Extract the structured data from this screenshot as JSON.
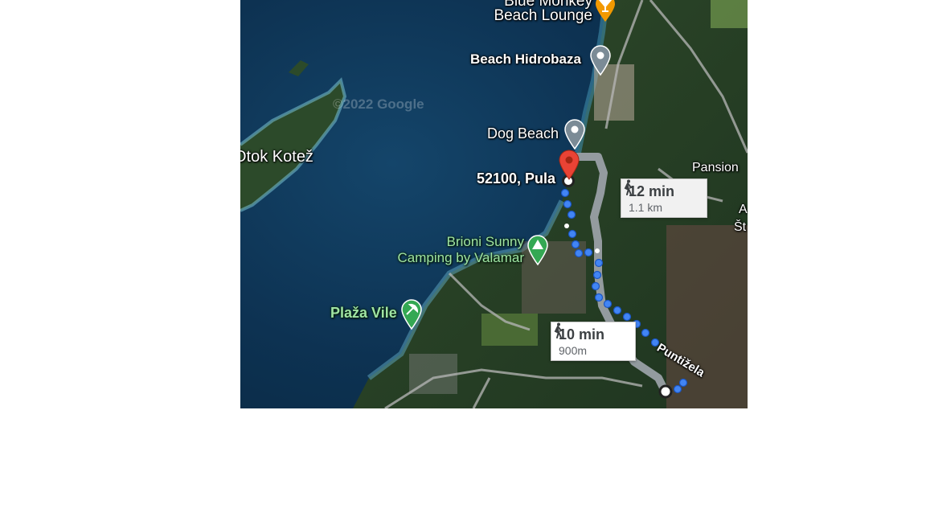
{
  "map": {
    "watermark": "©2022 Google",
    "places": {
      "blue_monkey": "Blue Monkey",
      "blue_monkey_2": "Beach Lounge",
      "beach_hidrobaza": "Beach Hidrobaza",
      "dog_beach": "Dog Beach",
      "otok_kotez": "Otok Kotež",
      "destination": "52100, Pula",
      "pansion": "Pansion",
      "edge_a": "A",
      "edge_st": "Št",
      "brioni_1": "Brioni Sunny",
      "brioni_2": "Camping by Valamar",
      "plaza_vile": "Plaža Vile",
      "street": "Puntižela"
    },
    "routes": [
      {
        "time": "12 min",
        "distance": "1.1 km",
        "selected": false
      },
      {
        "time": "10 min",
        "distance": "900m",
        "selected": true
      }
    ],
    "colors": {
      "route_primary": "#1a73e8",
      "route_alt": "#9aa0a6",
      "pin_red": "#ea4335",
      "pin_grey": "#7b8b96",
      "pin_green": "#34a853",
      "pin_orange": "#f29900"
    },
    "icons": [
      "walking-person-icon",
      "location-pin-icon",
      "cocktail-icon",
      "camping-icon",
      "beach-icon"
    ]
  }
}
